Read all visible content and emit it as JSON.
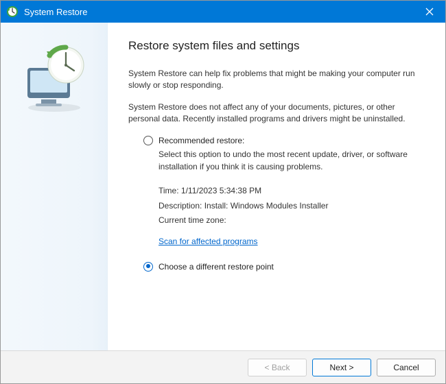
{
  "titlebar": {
    "title": "System Restore"
  },
  "main": {
    "heading": "Restore system files and settings",
    "para1": "System Restore can help fix problems that might be making your computer run slowly or stop responding.",
    "para2": "System Restore does not affect any of your documents, pictures, or other personal data. Recently installed programs and drivers might be uninstalled."
  },
  "options": {
    "recommended": {
      "label": "Recommended restore:",
      "detail": "Select this option to undo the most recent update, driver, or software installation if you think it is causing problems.",
      "time_label": "Time:",
      "time_value": "1/11/2023 5:34:38 PM",
      "desc_label": "Description:",
      "desc_value": "Install: Windows Modules Installer",
      "tz_label": "Current time zone:",
      "tz_value": "",
      "scan_link": "Scan for affected programs"
    },
    "different": {
      "label": "Choose a different restore point"
    },
    "selected": "different"
  },
  "footer": {
    "back": "< Back",
    "next": "Next >",
    "cancel": "Cancel"
  }
}
